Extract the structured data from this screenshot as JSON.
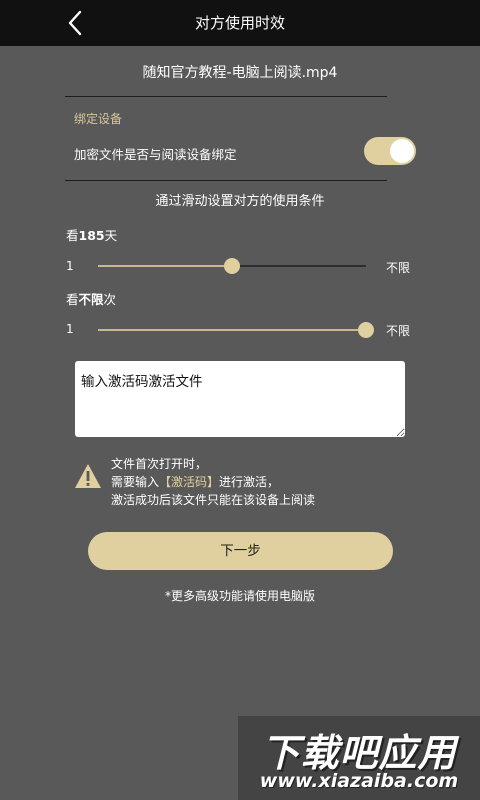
{
  "header": {
    "title": "对方使用时效",
    "back_icon": "chevron-left-icon"
  },
  "file": {
    "name": "随知官方教程-电脑上阅读.mp4"
  },
  "binding": {
    "section_label": "绑定设备",
    "question": "加密文件是否与阅读设备绑定",
    "toggle_on": true
  },
  "conditions": {
    "title": "通过滑动设置对方的使用条件",
    "days": {
      "caption_prefix": "看",
      "value": "185",
      "caption_suffix": "天",
      "min": "1",
      "max": "不限",
      "level": 0.5
    },
    "times": {
      "caption_prefix": "看",
      "value": "不限",
      "caption_suffix": "次",
      "min": "1",
      "max": "不限",
      "level": 1.0
    }
  },
  "activation": {
    "value": "输入激活码激活文件"
  },
  "notice": {
    "line1": "文件首次打开时，",
    "line2_prefix": "需要输入",
    "line2_highlight": "【激活码】",
    "line2_suffix": "进行激活，",
    "line3": "激活成功后该文件只能在该设备上阅读"
  },
  "next_button": {
    "label": "下一步"
  },
  "footer": {
    "note": "*更多高级功能请使用电脑版"
  },
  "watermark": {
    "title": "下载吧应用",
    "url": "www.xiazaiba.com"
  },
  "colors": {
    "accent": "#e0cf9f",
    "background": "#595959",
    "header": "#111111"
  }
}
